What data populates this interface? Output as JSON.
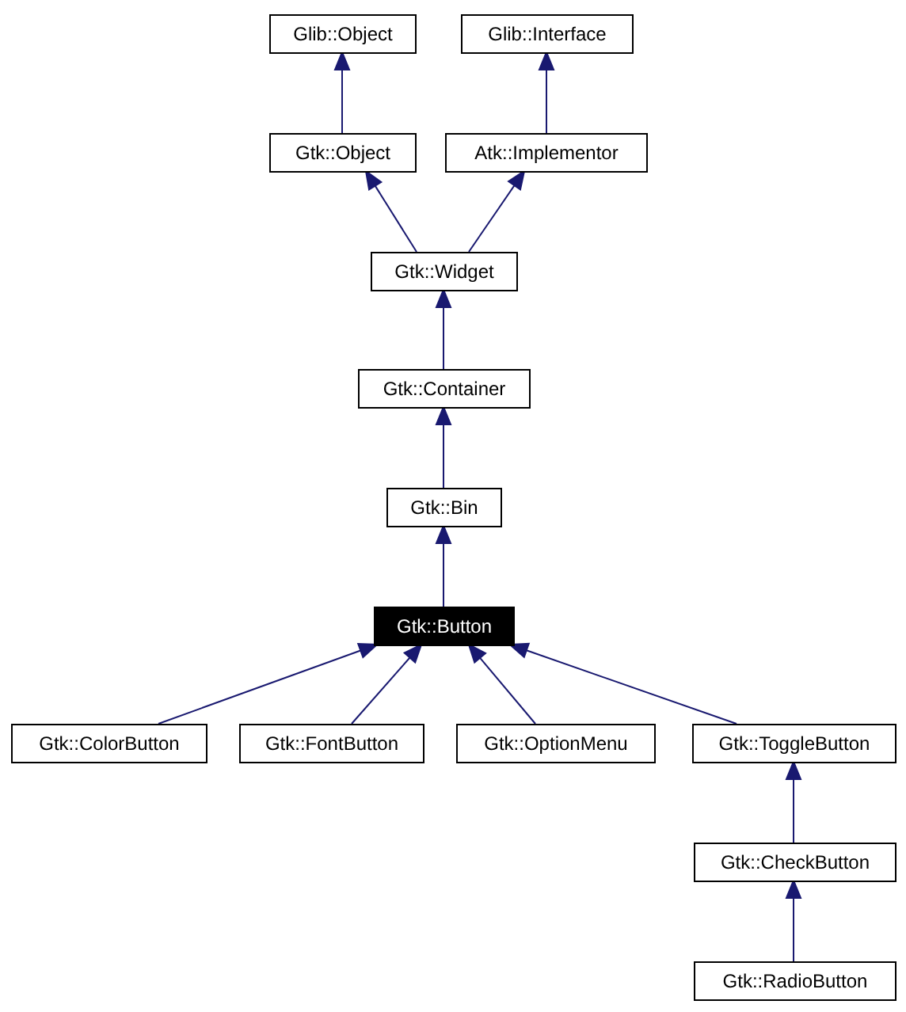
{
  "diagram": {
    "nodes": [
      {
        "label": "Glib::Object",
        "selected": false
      },
      {
        "label": "Glib::Interface",
        "selected": false
      },
      {
        "label": "Gtk::Object",
        "selected": false
      },
      {
        "label": "Atk::Implementor",
        "selected": false
      },
      {
        "label": "Gtk::Widget",
        "selected": false
      },
      {
        "label": "Gtk::Container",
        "selected": false
      },
      {
        "label": "Gtk::Bin",
        "selected": false
      },
      {
        "label": "Gtk::Button",
        "selected": true
      },
      {
        "label": "Gtk::ColorButton",
        "selected": false
      },
      {
        "label": "Gtk::FontButton",
        "selected": false
      },
      {
        "label": "Gtk::OptionMenu",
        "selected": false
      },
      {
        "label": "Gtk::ToggleButton",
        "selected": false
      },
      {
        "label": "Gtk::CheckButton",
        "selected": false
      },
      {
        "label": "Gtk::RadioButton",
        "selected": false
      }
    ]
  }
}
